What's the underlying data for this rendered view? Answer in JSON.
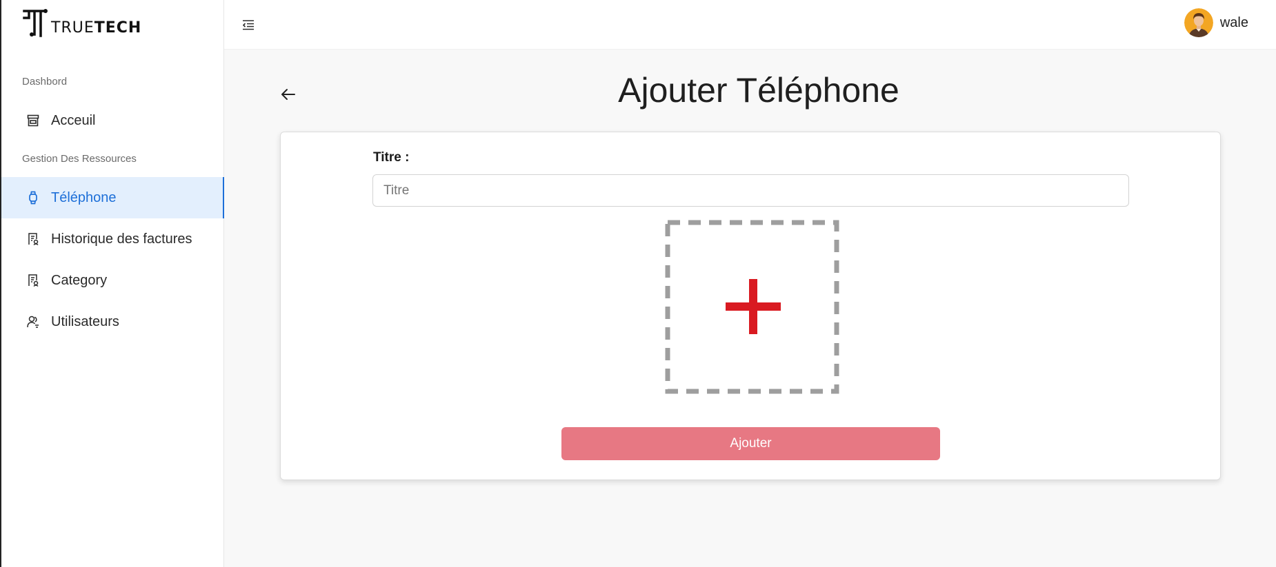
{
  "brand": {
    "name_light": "TRUE",
    "name_bold": "TECH"
  },
  "sidebar": {
    "sections": [
      {
        "label": "Dashbord"
      },
      {
        "label": "Gestion Des Ressources"
      }
    ],
    "items": [
      {
        "label": "Acceuil",
        "icon": "store-icon",
        "active": false
      },
      {
        "label": "Téléphone",
        "icon": "watch-icon",
        "active": true
      },
      {
        "label": "Historique des factures",
        "icon": "receipt-icon",
        "active": false
      },
      {
        "label": "Category",
        "icon": "receipt-icon",
        "active": false
      },
      {
        "label": "Utilisateurs",
        "icon": "users-icon",
        "active": false
      }
    ]
  },
  "header": {
    "username": "wale",
    "menu_icon": "menu-collapse-icon"
  },
  "page": {
    "title": "Ajouter Téléphone",
    "back_icon": "arrow-left-icon"
  },
  "form": {
    "title_label": "Titre :",
    "title_placeholder": "Titre",
    "title_value": "",
    "upload_icon": "plus-icon",
    "submit_label": "Ajouter"
  },
  "colors": {
    "accent": "#1d6fd8",
    "active_bg": "#e3effd",
    "submit_bg": "#e77883",
    "upload_plus": "#d91a21",
    "upload_border": "#9e9e9e"
  }
}
